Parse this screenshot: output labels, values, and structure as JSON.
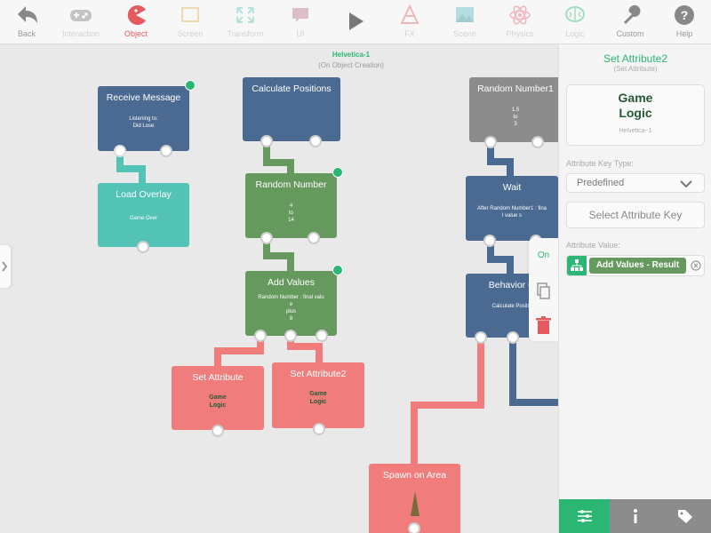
{
  "toolbar": {
    "back": "Back",
    "interaction": "Interaction",
    "object": "Object",
    "screen": "Screen",
    "transform": "Transform",
    "ui": "UI",
    "fx": "FX",
    "scene": "Scene",
    "physics": "Physics",
    "logic": "Logic",
    "custom": "Custom",
    "help": "Help"
  },
  "canvas": {
    "object_name": "Helvetica-1",
    "event_label": "(On Object Creation)"
  },
  "nodes": {
    "receive_message": {
      "title": "Receive Message",
      "line1": "Listening to:",
      "line2": "Did Lose"
    },
    "load_overlay": {
      "title": "Load Overlay",
      "body": "Game Over"
    },
    "calculate_positions": {
      "title": "Calculate Positions"
    },
    "random_number": {
      "title": "Random Number",
      "line1": "4",
      "line2": "to",
      "line3": "14"
    },
    "add_values": {
      "title": "Add Values",
      "line1": "Random Number : final valu",
      "line2": "e",
      "line3": "plus",
      "line4": "8"
    },
    "set_attribute": {
      "title": "Set Attribute",
      "line1": "Game",
      "line2": "Logic"
    },
    "set_attribute2": {
      "title": "Set Attribute2",
      "line1": "Game",
      "line2": "Logic"
    },
    "random_number1": {
      "title": "Random Number1",
      "line1": "1.5",
      "line2": "to",
      "line3": "3"
    },
    "wait": {
      "title": "Wait",
      "line1": "After Random Number1 : fina",
      "line2": "l value s"
    },
    "behavior": {
      "title": "Behavior O",
      "body": "Calculate Positio"
    },
    "spawn": {
      "title": "Spawn on Area"
    }
  },
  "popup": {
    "on": "On"
  },
  "sidebar": {
    "title": "Set Attribute2",
    "subtitle": "(Set Attribute)",
    "card_line1": "Game",
    "card_line2": "Logic",
    "card_caption": "Helvetica~1",
    "key_type_label": "Attribute Key Type:",
    "key_type_value": "Predefined",
    "select_key_button": "Select Attribute Key",
    "value_label": "Attribute Value:",
    "value_chip": "Add Values - Result"
  },
  "colors": {
    "accent": "#2bb673",
    "active_tab": "#e45a5f",
    "node_blue": "#4b6a92",
    "node_green": "#66995e",
    "node_teal": "#52c3b5",
    "node_gray": "#8c8c8c",
    "node_red": "#f07c7c"
  }
}
